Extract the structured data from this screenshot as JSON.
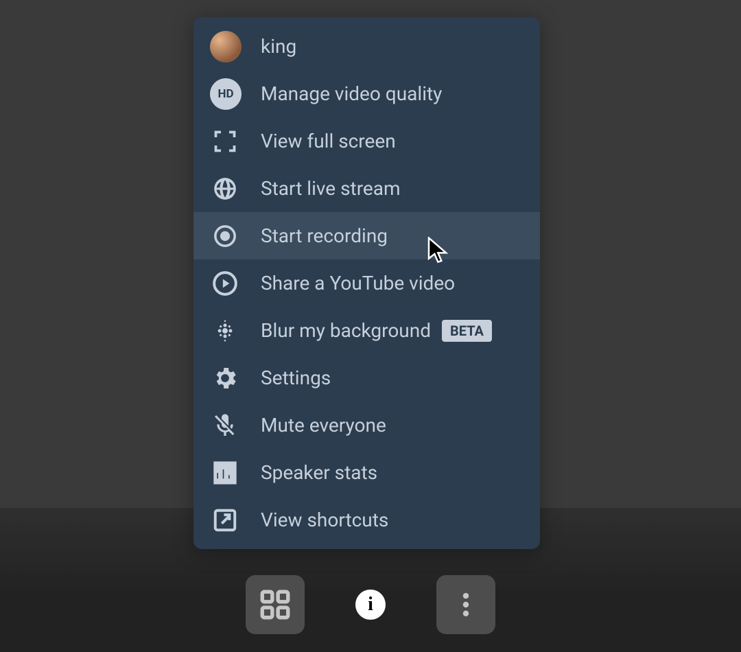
{
  "menu": {
    "user_label": "king",
    "hd_label": "HD",
    "items": {
      "quality": "Manage video quality",
      "fullscreen": "View full screen",
      "livestream": "Start live stream",
      "recording": "Start recording",
      "youtube": "Share a YouTube video",
      "blur": "Blur my background",
      "blur_badge": "BETA",
      "settings": "Settings",
      "mute_all": "Mute everyone",
      "speaker_stats": "Speaker stats",
      "shortcuts": "View shortcuts"
    }
  },
  "toolbar": {
    "info_glyph": "i"
  }
}
